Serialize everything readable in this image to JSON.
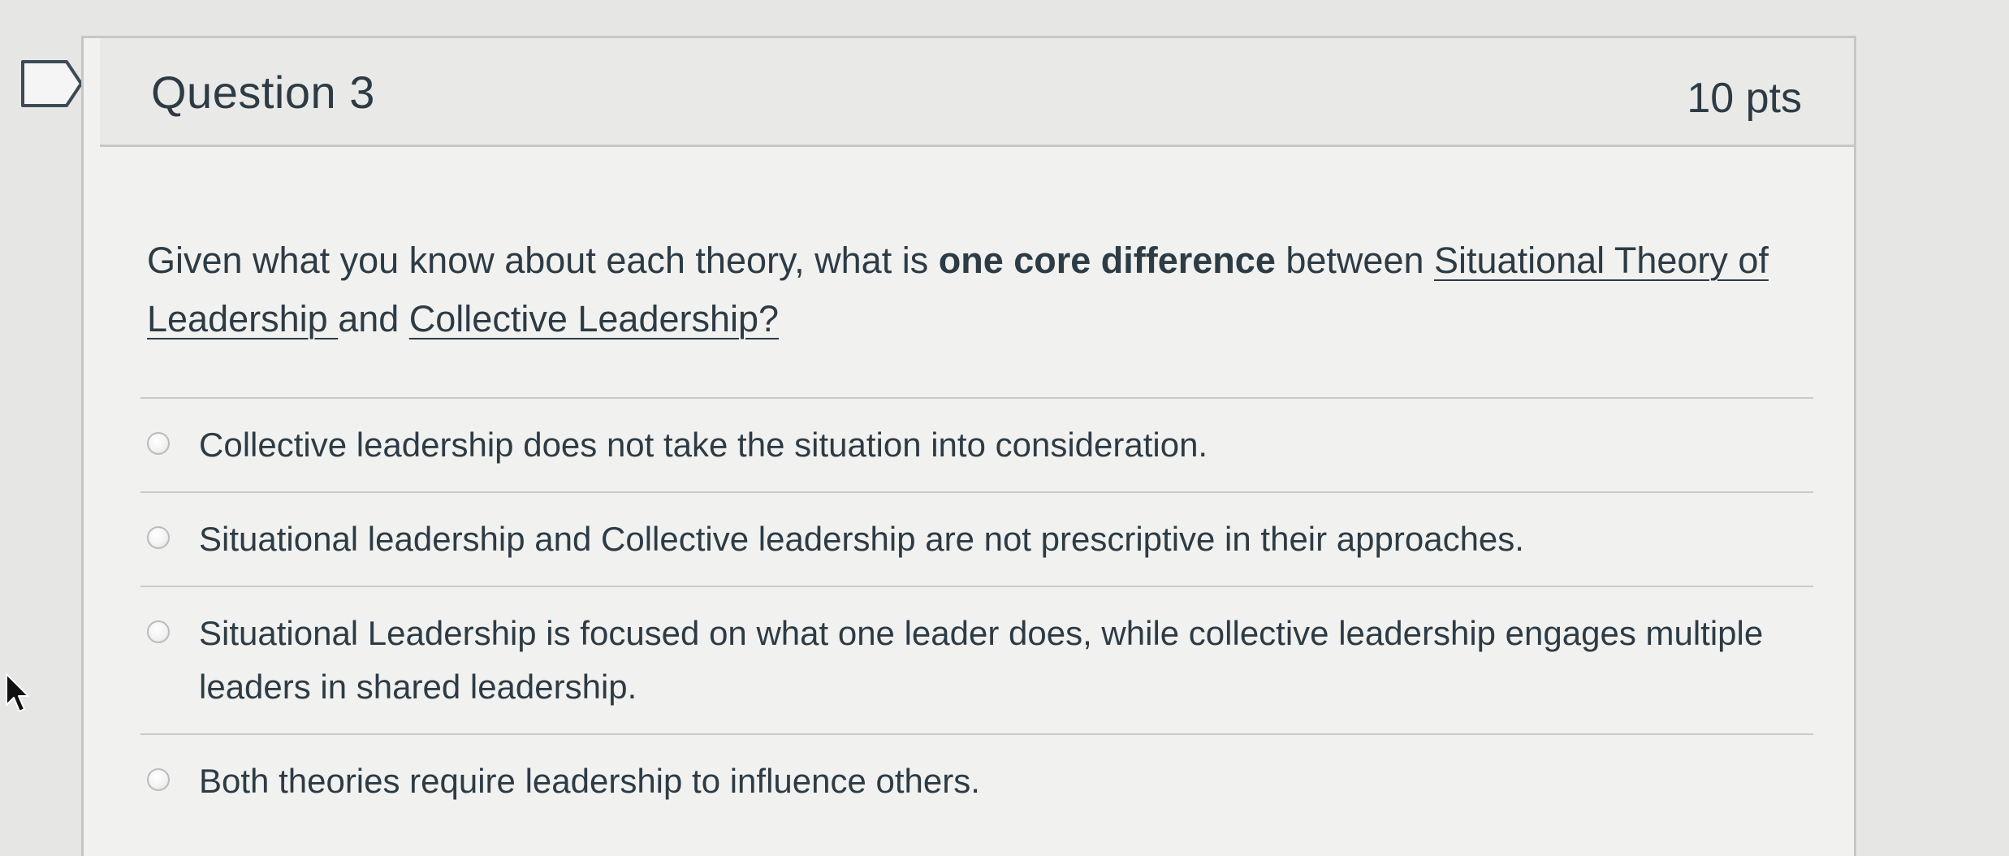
{
  "question": {
    "title": "Question 3",
    "points": "10 pts",
    "text": {
      "part1": "Given what you know about each theory, what is ",
      "bold": "one core difference",
      "part2": " between ",
      "link1": "Situational Theory of Leadership ",
      "part3": "and ",
      "link2": "Collective Leadership?"
    }
  },
  "answers": [
    {
      "label": "Collective leadership does not take the situation into consideration."
    },
    {
      "label": "Situational leadership and Collective leadership are not prescriptive in their approaches."
    },
    {
      "label": "Situational Leadership is focused on what one leader does, while collective leadership engages multiple leaders in shared leadership."
    },
    {
      "label": "Both theories require leadership to influence others."
    }
  ],
  "colors": {
    "text": "#2d3b45",
    "border": "#c4c7c5",
    "background": "#e6e7e5"
  },
  "icons": {
    "flag": "flag-outline-icon",
    "cursor": "mouse-pointer-icon",
    "radio": "radio-unselected-icon"
  }
}
